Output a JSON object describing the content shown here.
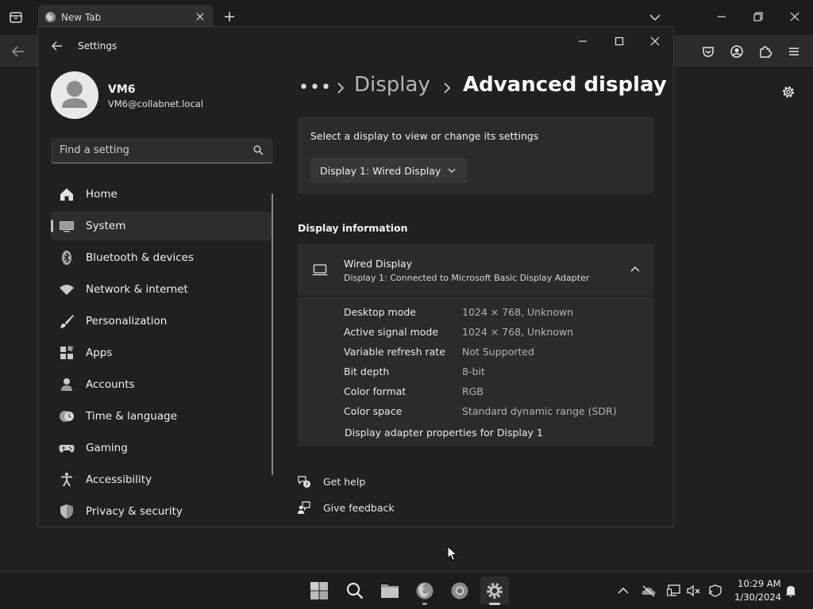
{
  "browser": {
    "tab_title": "New Tab"
  },
  "settings": {
    "app_title": "Settings",
    "profile": {
      "name": "VM6",
      "email": "VM6@collabnet.local"
    },
    "search": {
      "placeholder": "Find a setting"
    },
    "nav": [
      {
        "label": "Home",
        "icon": "home-icon"
      },
      {
        "label": "System",
        "icon": "system-icon",
        "selected": true
      },
      {
        "label": "Bluetooth & devices",
        "icon": "bluetooth-icon"
      },
      {
        "label": "Network & internet",
        "icon": "wifi-icon"
      },
      {
        "label": "Personalization",
        "icon": "brush-icon"
      },
      {
        "label": "Apps",
        "icon": "apps-icon"
      },
      {
        "label": "Accounts",
        "icon": "person-icon"
      },
      {
        "label": "Time & language",
        "icon": "globe-clock-icon"
      },
      {
        "label": "Gaming",
        "icon": "gamepad-icon"
      },
      {
        "label": "Accessibility",
        "icon": "accessibility-icon"
      },
      {
        "label": "Privacy & security",
        "icon": "shield-icon"
      }
    ],
    "breadcrumb": {
      "more": "•••",
      "parent": "Display",
      "current": "Advanced display"
    },
    "select_display": {
      "prompt": "Select a display to view or change its settings",
      "selected": "Display 1: Wired Display"
    },
    "display_info": {
      "section_title": "Display information",
      "display_name": "Wired Display",
      "display_subtitle": "Display 1: Connected to Microsoft Basic Display Adapter",
      "rows": [
        {
          "key": "Desktop mode",
          "value": "1024 × 768, Unknown"
        },
        {
          "key": "Active signal mode",
          "value": "1024 × 768, Unknown"
        },
        {
          "key": "Variable refresh rate",
          "value": "Not Supported"
        },
        {
          "key": "Bit depth",
          "value": "8-bit"
        },
        {
          "key": "Color format",
          "value": "RGB"
        },
        {
          "key": "Color space",
          "value": "Standard dynamic range (SDR)"
        }
      ],
      "adapter_link": "Display adapter properties for Display 1"
    },
    "help": {
      "get_help": "Get help",
      "give_feedback": "Give feedback"
    }
  },
  "taskbar": {
    "time": "10:29 AM",
    "date": "1/30/2024"
  }
}
